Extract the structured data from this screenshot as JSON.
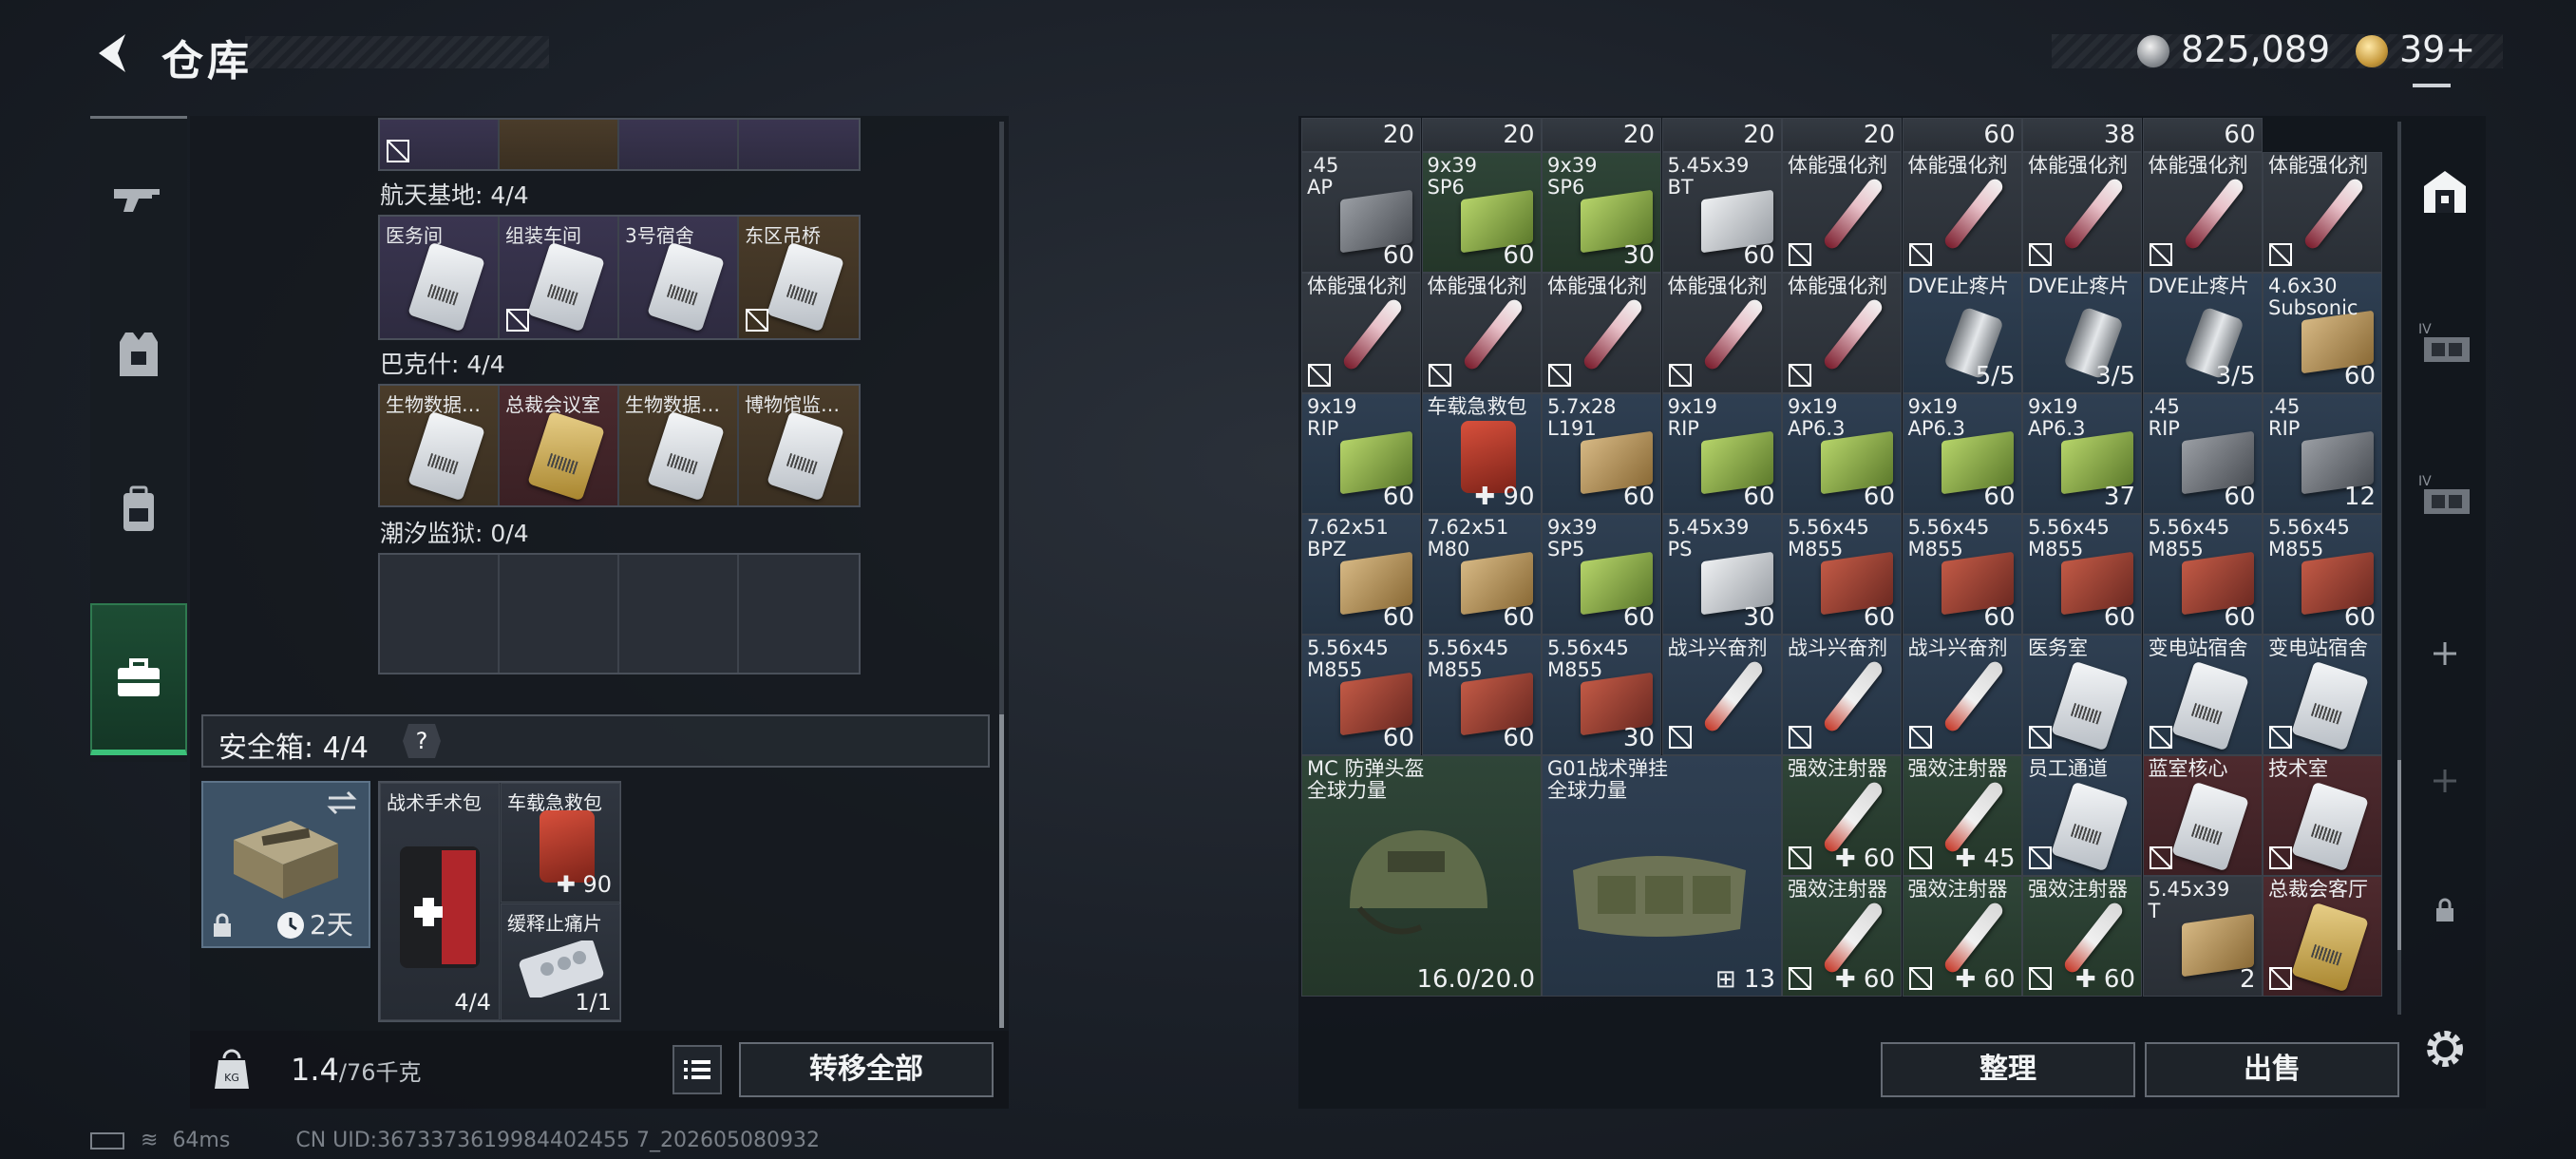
{
  "header": {
    "title": "仓库",
    "silver": "825,089",
    "gold": "39+"
  },
  "nav": {
    "items": [
      "weapon",
      "armor",
      "backpack",
      "case"
    ]
  },
  "groups": [
    {
      "label": "航天基地: 4/4",
      "slots": [
        "医务间",
        "组装车间",
        "3号宿舍",
        "东区吊桥"
      ]
    },
    {
      "label": "巴克什: 4/4",
      "slots": [
        "生物数据…",
        "总裁会议室",
        "生物数据…",
        "博物馆监…"
      ]
    },
    {
      "label": "潮汐监狱: 0/4"
    }
  ],
  "safebox": {
    "title": "安全箱: 4/4",
    "help": "?",
    "duration": "2天",
    "items": [
      {
        "name": "战术手术包",
        "count": "4/4"
      },
      {
        "name": "车载急救包",
        "count": "90"
      },
      {
        "name": "缓释止痛片",
        "count": "1/1"
      }
    ]
  },
  "weight": {
    "value": "1.4",
    "capacity": "/76千克",
    "icon": "KG"
  },
  "buttons": {
    "transfer": "转移全部",
    "sort": "整理",
    "sell": "出售"
  },
  "grid": {
    "top_row_counts": [
      "20",
      "20",
      "20",
      "20",
      "20",
      "60",
      "38",
      "60"
    ],
    "rows": [
      [
        {
          "n": ".45\nAP",
          "c": "60",
          "t": "ammo",
          "k": "grey",
          "bg": "grey"
        },
        {
          "n": "9x39\nSP6",
          "c": "60",
          "t": "ammo",
          "k": "green",
          "bg": "green"
        },
        {
          "n": "9x39\nSP6",
          "c": "30",
          "t": "ammo",
          "k": "green",
          "bg": "green"
        },
        {
          "n": "5.45x39\nBT",
          "c": "60",
          "t": "ammo",
          "k": "white",
          "bg": "grey"
        },
        {
          "n": "体能强化剂",
          "c": "",
          "t": "syr",
          "bg": "grey"
        },
        {
          "n": "体能强化剂",
          "c": "",
          "t": "syr",
          "bg": "grey"
        },
        {
          "n": "体能强化剂",
          "c": "",
          "t": "syr",
          "bg": "grey"
        },
        {
          "n": "体能强化剂",
          "c": "",
          "t": "syr",
          "bg": "grey"
        },
        {
          "n": "体能强化剂",
          "c": "",
          "t": "syr",
          "bg": "grey"
        }
      ],
      [
        {
          "n": "体能强化剂",
          "c": "",
          "t": "syr",
          "bg": "grey"
        },
        {
          "n": "体能强化剂",
          "c": "",
          "t": "syr",
          "bg": "grey"
        },
        {
          "n": "体能强化剂",
          "c": "",
          "t": "syr",
          "bg": "grey"
        },
        {
          "n": "体能强化剂",
          "c": "",
          "t": "syr",
          "bg": "grey"
        },
        {
          "n": "体能强化剂",
          "c": "",
          "t": "syr",
          "bg": "grey"
        },
        {
          "n": "DVE止疼片",
          "c": "5/5",
          "t": "pill",
          "bg": "blue"
        },
        {
          "n": "DVE止疼片",
          "c": "3/5",
          "t": "pill",
          "bg": "blue"
        },
        {
          "n": "DVE止疼片",
          "c": "3/5",
          "t": "pill",
          "bg": "blue"
        },
        {
          "n": "4.6x30\nSubsonic",
          "c": "60",
          "t": "ammo",
          "k": "tan",
          "bg": "blue"
        }
      ],
      [
        {
          "n": "9x19\nRIP",
          "c": "60",
          "t": "ammo",
          "k": "green",
          "bg": "blue"
        },
        {
          "n": "车载急救包",
          "c": "90",
          "t": "med",
          "bg": "blue"
        },
        {
          "n": "5.7x28\nL191",
          "c": "60",
          "t": "ammo",
          "k": "tan",
          "bg": "blue"
        },
        {
          "n": "9x19\nRIP",
          "c": "60",
          "t": "ammo",
          "k": "green",
          "bg": "blue"
        },
        {
          "n": "9x19\nAP6.3",
          "c": "60",
          "t": "ammo",
          "k": "green",
          "bg": "blue"
        },
        {
          "n": "9x19\nAP6.3",
          "c": "60",
          "t": "ammo",
          "k": "green",
          "bg": "blue"
        },
        {
          "n": "9x19\nAP6.3",
          "c": "37",
          "t": "ammo",
          "k": "green",
          "bg": "blue"
        },
        {
          "n": ".45\nRIP",
          "c": "60",
          "t": "ammo",
          "k": "grey",
          "bg": "blue"
        },
        {
          "n": ".45\nRIP",
          "c": "12",
          "t": "ammo",
          "k": "grey",
          "bg": "blue"
        }
      ],
      [
        {
          "n": "7.62x51\nBPZ",
          "c": "60",
          "t": "ammo",
          "k": "tan",
          "bg": "blue"
        },
        {
          "n": "7.62x51\nM80",
          "c": "60",
          "t": "ammo",
          "k": "tan",
          "bg": "blue"
        },
        {
          "n": "9x39\nSP5",
          "c": "60",
          "t": "ammo",
          "k": "green",
          "bg": "blue"
        },
        {
          "n": "5.45x39\nPS",
          "c": "30",
          "t": "ammo",
          "k": "white",
          "bg": "blue"
        },
        {
          "n": "5.56x45\nM855",
          "c": "60",
          "t": "ammo",
          "k": "red",
          "bg": "blue"
        },
        {
          "n": "5.56x45\nM855",
          "c": "60",
          "t": "ammo",
          "k": "red",
          "bg": "blue"
        },
        {
          "n": "5.56x45\nM855",
          "c": "60",
          "t": "ammo",
          "k": "red",
          "bg": "blue"
        },
        {
          "n": "5.56x45\nM855",
          "c": "60",
          "t": "ammo",
          "k": "red",
          "bg": "blue"
        },
        {
          "n": "5.56x45\nM855",
          "c": "60",
          "t": "ammo",
          "k": "red",
          "bg": "blue"
        }
      ],
      [
        {
          "n": "5.56x45\nM855",
          "c": "60",
          "t": "ammo",
          "k": "red",
          "bg": "blue"
        },
        {
          "n": "5.56x45\nM855",
          "c": "60",
          "t": "ammo",
          "k": "red",
          "bg": "blue"
        },
        {
          "n": "5.56x45\nM855",
          "c": "30",
          "t": "ammo",
          "k": "red",
          "bg": "blue"
        },
        {
          "n": "战斗兴奋剂",
          "c": "",
          "t": "syrw",
          "bg": "blue"
        },
        {
          "n": "战斗兴奋剂",
          "c": "",
          "t": "syrw",
          "bg": "blue"
        },
        {
          "n": "战斗兴奋剂",
          "c": "",
          "t": "syrw",
          "bg": "blue"
        },
        {
          "n": "医务室",
          "c": "",
          "t": "card",
          "bg": "blue"
        },
        {
          "n": "变电站宿舍",
          "c": "",
          "t": "card",
          "bg": "blue"
        },
        {
          "n": "变电站宿舍",
          "c": "",
          "t": "card",
          "bg": "blue"
        }
      ]
    ],
    "helmet": {
      "name": "MC 防弹头盔\n全球力量",
      "durability": "16.0/20.0"
    },
    "rig": {
      "name": "G01战术弹挂\n全球力量",
      "count": "13"
    },
    "row6": [
      {
        "n": "强效注射器",
        "c": "60",
        "t": "syrw",
        "bg": "green"
      },
      {
        "n": "强效注射器",
        "c": "45",
        "t": "syrw",
        "bg": "green"
      },
      {
        "n": "员工通道",
        "c": "",
        "t": "card",
        "bg": "blue"
      },
      {
        "n": "蓝室核心",
        "c": "",
        "t": "card",
        "bg": "red"
      },
      {
        "n": "技术室",
        "c": "",
        "t": "card",
        "bg": "red"
      }
    ],
    "row7": [
      {
        "n": "强效注射器",
        "c": "60",
        "t": "syrw",
        "bg": "green"
      },
      {
        "n": "强效注射器",
        "c": "60",
        "t": "syrw",
        "bg": "green"
      },
      {
        "n": "强效注射器",
        "c": "60",
        "t": "syrw",
        "bg": "green"
      },
      {
        "n": "5.45x39\nT",
        "c": "2",
        "t": "ammo",
        "k": "tan",
        "bg": "grey"
      },
      {
        "n": "总裁会客厅",
        "c": "",
        "t": "goldcard",
        "bg": "red"
      }
    ]
  },
  "side_tools": [
    "vault-icon",
    "tier-4-rig-icon",
    "tier-4-rig-icon",
    "add-icon",
    "add-icon",
    "lock-icon"
  ],
  "status": {
    "ping": "64ms",
    "uid": "CN UID:3673373619984402455 7_202605080932"
  }
}
